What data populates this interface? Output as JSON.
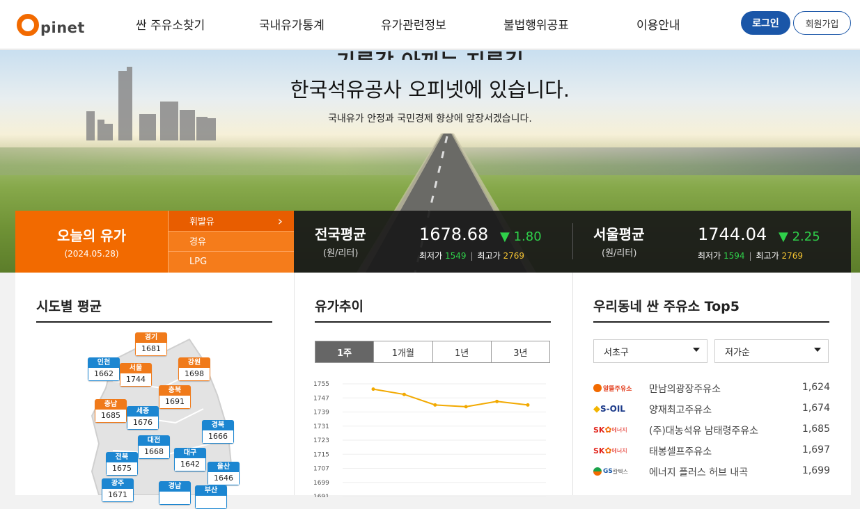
{
  "header": {
    "logo_text": "pinet",
    "nav": [
      "싼 주유소찾기",
      "국내유가통계",
      "유가관련정보",
      "불법행위공표",
      "이용안내"
    ],
    "login": "로그인",
    "join": "회원가입"
  },
  "hero": {
    "clipped_line": "기름값 아끼는 지름길",
    "title": "한국석유공사 오피넷에 있습니다.",
    "subtitle": "국내유가 안정과 국민경제 향상에 앞장서겠습니다."
  },
  "today": {
    "title": "오늘의 유가",
    "date": "(2024.05.28)",
    "fuel_tabs": [
      "휘발유",
      "경유",
      "LPG"
    ],
    "active_fuel": "휘발유"
  },
  "national_avg": {
    "label": "전국평균",
    "unit": "(원/리터)",
    "value": "1678.68",
    "change": "▼ 1.80",
    "min_label": "최저가",
    "min": "1549",
    "max_label": "최고가",
    "max": "2769"
  },
  "seoul_avg": {
    "label": "서울평균",
    "unit": "(원/리터)",
    "value": "1744.04",
    "change": "▼ 2.25",
    "min_label": "최저가",
    "min": "1594",
    "max_label": "최고가",
    "max": "2769"
  },
  "regional": {
    "title": "시도별 평균",
    "regions": [
      {
        "name": "경기",
        "value": "1681",
        "color": "orange"
      },
      {
        "name": "인천",
        "value": "1662",
        "color": "blue"
      },
      {
        "name": "서울",
        "value": "1744",
        "color": "orange"
      },
      {
        "name": "강원",
        "value": "1698",
        "color": "orange"
      },
      {
        "name": "충북",
        "value": "1691",
        "color": "orange"
      },
      {
        "name": "충남",
        "value": "1685",
        "color": "orange"
      },
      {
        "name": "세종",
        "value": "1676",
        "color": "blue"
      },
      {
        "name": "경북",
        "value": "1666",
        "color": "blue"
      },
      {
        "name": "대전",
        "value": "1668",
        "color": "blue"
      },
      {
        "name": "전북",
        "value": "1675",
        "color": "blue"
      },
      {
        "name": "대구",
        "value": "1642",
        "color": "blue"
      },
      {
        "name": "울산",
        "value": "1646",
        "color": "blue"
      },
      {
        "name": "광주",
        "value": "1671",
        "color": "blue"
      },
      {
        "name": "경남",
        "value": "",
        "color": "blue"
      },
      {
        "name": "부산",
        "value": "",
        "color": "blue"
      }
    ]
  },
  "trend": {
    "title": "유가추이",
    "tabs": [
      "1주",
      "1개월",
      "1년",
      "3년"
    ],
    "active_tab": "1주"
  },
  "chart_data": {
    "type": "line",
    "title": "",
    "xlabel": "",
    "ylabel": "",
    "ylim": [
      1691,
      1755
    ],
    "yticks": [
      1755,
      1747,
      1739,
      1731,
      1723,
      1715,
      1707,
      1699,
      1691
    ],
    "series": [
      {
        "values": [
          1752,
          1749,
          1743,
          1742,
          1745,
          1743
        ],
        "color": "#f2a900"
      }
    ],
    "grid": true
  },
  "top5": {
    "title": "우리동네 싼 주유소 Top5",
    "district": "서초구",
    "sort": "저가순",
    "stations": [
      {
        "brand": "알뜰주유소",
        "brand_icon": "altteul-logo",
        "name": "만남의광장주유소",
        "price": "1,624"
      },
      {
        "brand": "S-OIL",
        "brand_icon": "soil-logo",
        "name": "양재최고주유소",
        "price": "1,674"
      },
      {
        "brand": "SK에너지",
        "brand_icon": "sk-logo",
        "name": "(주)대농석유 남태령주유소",
        "price": "1,685"
      },
      {
        "brand": "SK에너지",
        "brand_icon": "sk-logo",
        "name": "태봉셀프주유소",
        "price": "1,697"
      },
      {
        "brand": "GS칼텍스",
        "brand_icon": "gs-logo",
        "name": "에너지 플러스 허브 내곡",
        "price": "1,699"
      }
    ]
  },
  "colors": {
    "brand_orange": "#f26a00",
    "login_blue": "#1a56a8",
    "down_green": "#2fd04a",
    "max_yellow": "#f2c231",
    "region_blue": "#1c86d1",
    "line_yellow": "#f2a900"
  }
}
